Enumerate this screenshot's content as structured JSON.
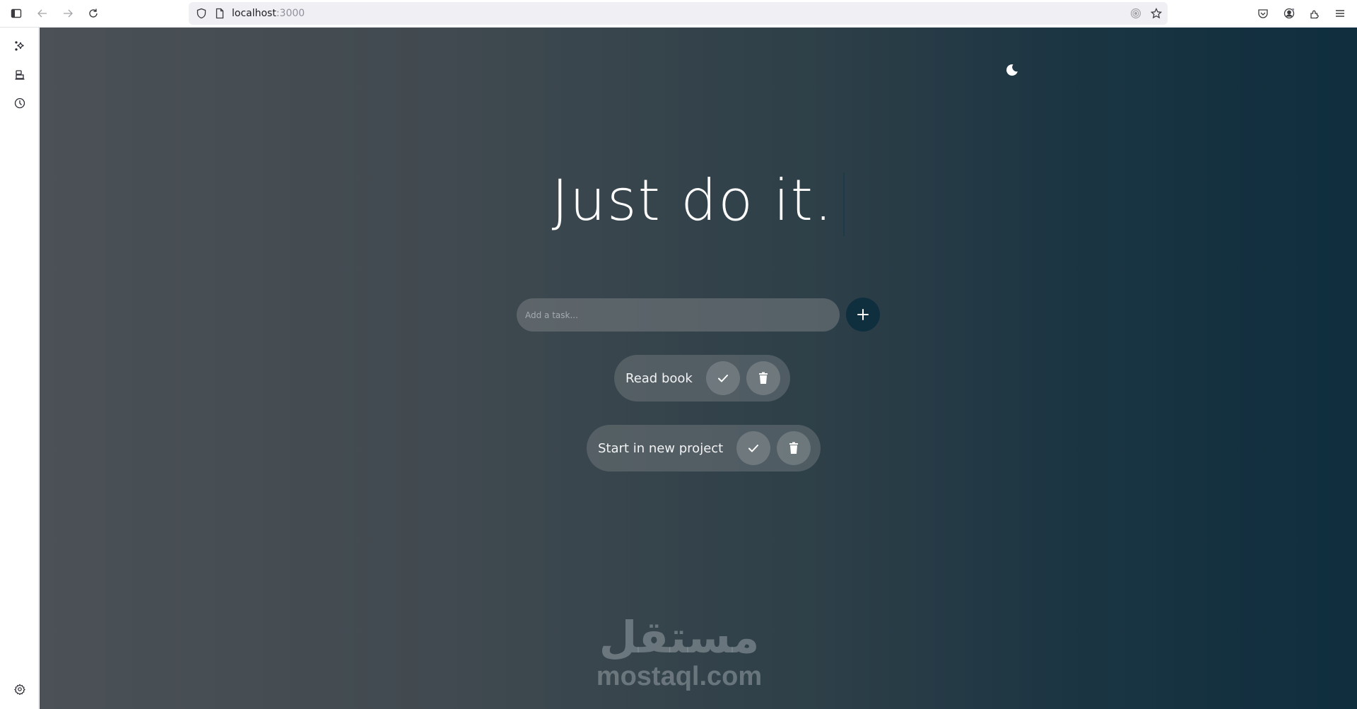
{
  "browser": {
    "url_host": "localhost",
    "url_port": ":3000",
    "toolbar_icons": [
      "sidebar-toggle-icon",
      "back-icon",
      "forward-icon",
      "reload-icon",
      "shield-icon",
      "page-icon",
      "tracking-icon",
      "bookmark-star-icon",
      "pocket-icon",
      "account-icon",
      "extensions-icon",
      "menu-icon"
    ]
  },
  "sidebar": {
    "icons": [
      "ai-sparkle-icon",
      "synced-tabs-icon",
      "history-icon",
      "settings-icon"
    ]
  },
  "app": {
    "theme_toggle": "moon-icon",
    "title": "Just do it.",
    "input": {
      "placeholder": "Add a task...",
      "value": ""
    },
    "add_button_icon": "plus-icon",
    "tasks": [
      {
        "label": "Read book",
        "complete_icon": "check-icon",
        "delete_icon": "trash-icon"
      },
      {
        "label": "Start in new project",
        "complete_icon": "check-icon",
        "delete_icon": "trash-icon"
      }
    ],
    "colors": {
      "accent": "#0f2e3e",
      "gradient_start": "#4b5156",
      "gradient_end": "#0f2e3e",
      "text": "#ffffff"
    }
  },
  "watermark": {
    "arabic": "مستقل",
    "latin": "mostaql.com"
  }
}
